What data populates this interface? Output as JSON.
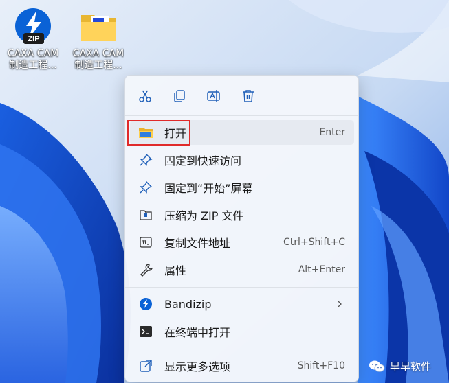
{
  "desktop": {
    "icons": [
      {
        "name": "CAXA CAM",
        "subtitle": "制造工程...",
        "badge": "ZIP"
      },
      {
        "name": "CAXA CAM",
        "subtitle": "制造工程..."
      }
    ]
  },
  "context_menu": {
    "toolbar": [
      {
        "icon": "cut-icon",
        "label": "剪切"
      },
      {
        "icon": "copy-icon",
        "label": "复制"
      },
      {
        "icon": "rename-icon",
        "label": "重命名"
      },
      {
        "icon": "delete-icon",
        "label": "删除"
      }
    ],
    "items": [
      {
        "label": "打开",
        "shortcut": "Enter",
        "icon": "folder-icon",
        "highlighted": true
      },
      {
        "label": "固定到快速访问",
        "shortcut": "",
        "icon": "pin-icon"
      },
      {
        "label": "固定到“开始”屏幕",
        "shortcut": "",
        "icon": "pin-icon"
      },
      {
        "label": "压缩为 ZIP 文件",
        "shortcut": "",
        "icon": "zip-folder-icon"
      },
      {
        "label": "复制文件地址",
        "shortcut": "Ctrl+Shift+C",
        "icon": "copy-path-icon"
      },
      {
        "label": "属性",
        "shortcut": "Alt+Enter",
        "icon": "wrench-icon"
      },
      {
        "label": "Bandizip",
        "shortcut": "",
        "icon": "bandizip-icon",
        "submenu": true
      },
      {
        "label": "在终端中打开",
        "shortcut": "",
        "icon": "terminal-icon"
      },
      {
        "label": "显示更多选项",
        "shortcut": "Shift+F10",
        "icon": "more-options-icon"
      }
    ]
  },
  "watermark": {
    "text": "早早软件",
    "icon": "wechat-icon"
  },
  "colors": {
    "accent": "#0067c0",
    "highlight_border": "#e02a2a",
    "menu_bg": "#f3f6fb"
  }
}
